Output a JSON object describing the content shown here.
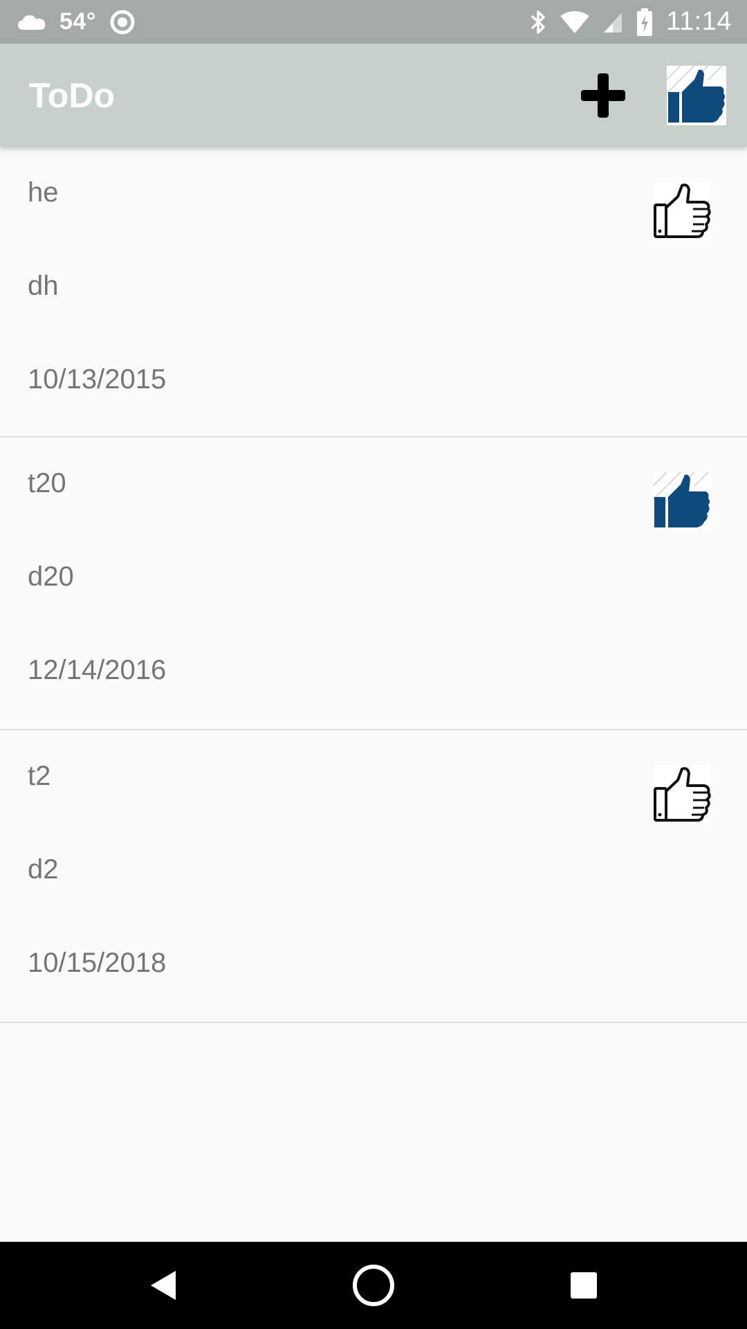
{
  "status_bar": {
    "temperature": "54°",
    "time": "11:14",
    "icons": [
      "cloud-icon",
      "circle-indicator-icon",
      "bluetooth-icon",
      "wifi-icon",
      "cell-signal-icon",
      "battery-charging-icon"
    ]
  },
  "app_bar": {
    "title": "ToDo",
    "actions": [
      "plus-icon",
      "thumbs-up-filled-icon"
    ]
  },
  "todos": [
    {
      "title": "he",
      "description": "dh",
      "date": "10/13/2015",
      "liked": false
    },
    {
      "title": "t20",
      "description": "d20",
      "date": "12/14/2016",
      "liked": true
    },
    {
      "title": "t2",
      "description": "d2",
      "date": "10/15/2018",
      "liked": false
    }
  ],
  "nav_bar": {
    "buttons": [
      "back-icon",
      "home-icon",
      "recents-icon"
    ]
  },
  "colors": {
    "status_bar": "#a4aaa6",
    "app_bar": "#c8d0cb",
    "thumb_blue": "#0f4a7d",
    "text_gray": "#757575"
  }
}
